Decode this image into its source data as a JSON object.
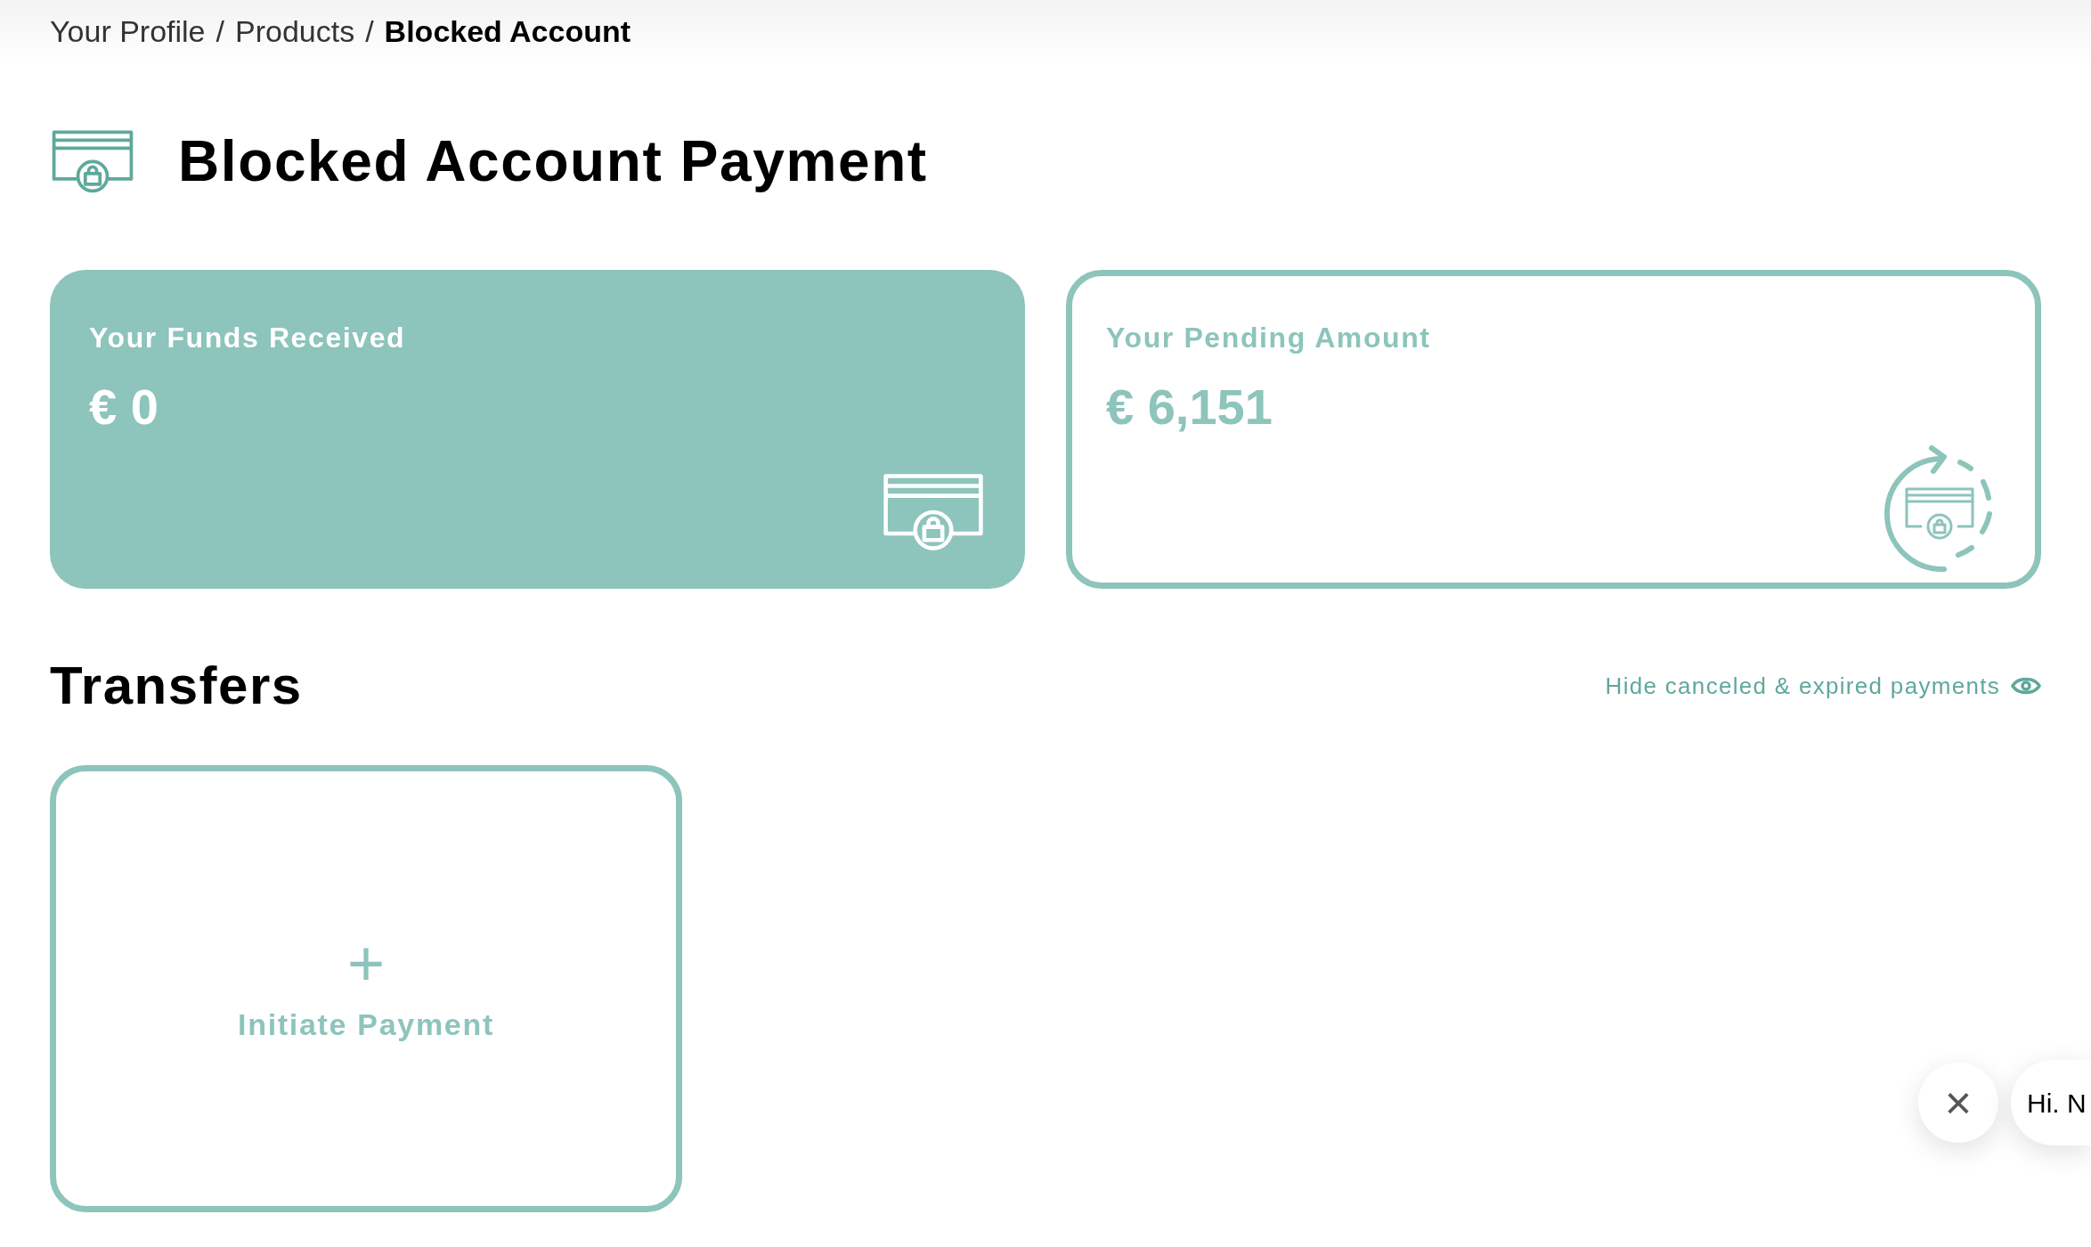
{
  "breadcrumb": [
    {
      "label": "Your Profile",
      "current": false
    },
    {
      "label": "/",
      "current": false
    },
    {
      "label": "Products",
      "current": false
    },
    {
      "label": "/",
      "current": false
    },
    {
      "label": "Blocked Account",
      "current": true
    }
  ],
  "page_title": "Blocked Account Payment",
  "summary_cards": [
    {
      "kind": "filled",
      "label": "Your Funds Received",
      "amount": "€ 0"
    },
    {
      "kind": "outline",
      "label": "Your Pending Amount",
      "amount": "€ 6,151"
    }
  ],
  "transfers": {
    "heading": "Transfers",
    "toggle_link": "Hide canceled & expired payments",
    "new_card": {
      "icon": "+",
      "label": "Initiate Payment"
    }
  },
  "chat": {
    "close": "×",
    "greeting": "Hi. N"
  }
}
